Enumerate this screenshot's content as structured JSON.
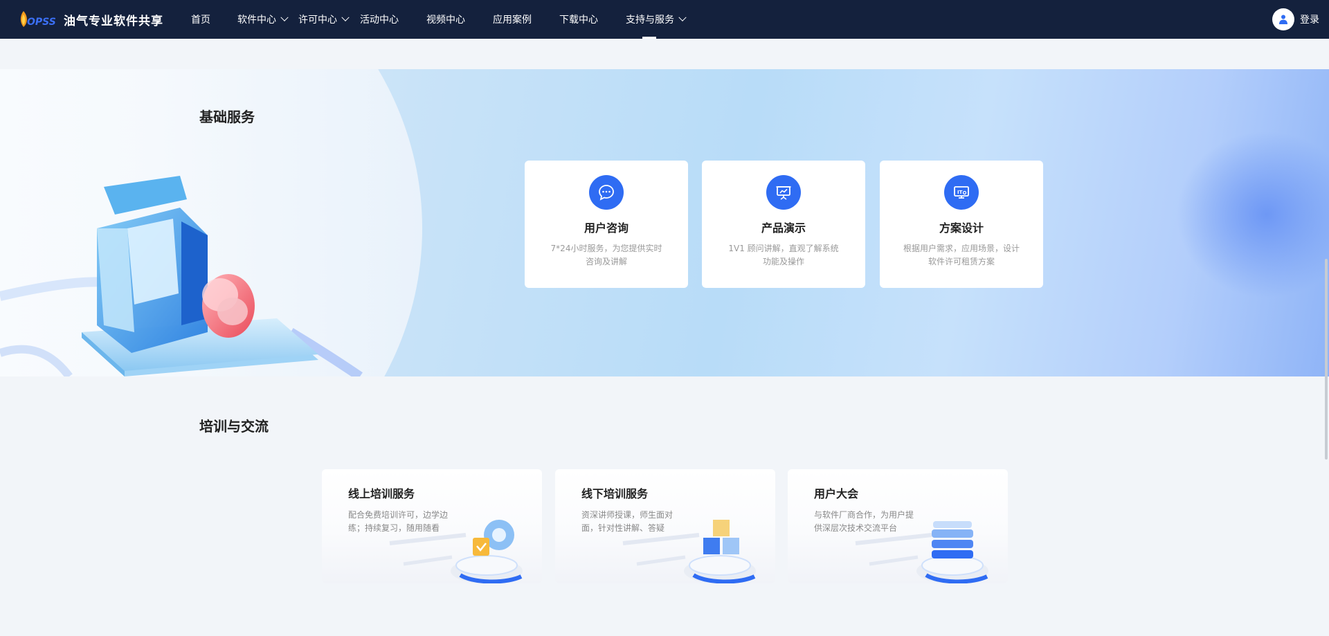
{
  "brand": {
    "logo_text": "OPSS",
    "name": "油气专业软件共享"
  },
  "nav": {
    "items": [
      {
        "label": "首页",
        "dropdown": false
      },
      {
        "label": "软件中心",
        "dropdown": true
      },
      {
        "label": "许可中心",
        "dropdown": true
      },
      {
        "label": "活动中心",
        "dropdown": false
      },
      {
        "label": "视频中心",
        "dropdown": false
      },
      {
        "label": "应用案例",
        "dropdown": false
      },
      {
        "label": "下载中心",
        "dropdown": false
      },
      {
        "label": "支持与服务",
        "dropdown": true,
        "active": true
      }
    ],
    "login_label": "登录"
  },
  "basic_services": {
    "title": "基础服务",
    "cards": [
      {
        "icon": "chat-bubble-icon",
        "title": "用户咨询",
        "desc": "7*24小时服务，为您提供实时咨询及讲解"
      },
      {
        "icon": "presentation-board-icon",
        "title": "产品演示",
        "desc": "1V1 顾问讲解，直观了解系统功能及操作"
      },
      {
        "icon": "it-monitor-icon",
        "title": "方案设计",
        "desc": "根据用户需求，应用场景，设计软件许可租赁方案"
      }
    ]
  },
  "training": {
    "title": "培训与交流",
    "cards": [
      {
        "icon": "gear-shield-icon",
        "title": "线上培训服务",
        "desc": "配合免费培训许可，边学边练；持续复习，随用随看"
      },
      {
        "icon": "cubes-icon",
        "title": "线下培训服务",
        "desc": "资深讲师授课，师生面对面，针对性讲解、答疑"
      },
      {
        "icon": "server-stack-icon",
        "title": "用户大会",
        "desc": "与软件厂商合作，为用户提供深层次技术交流平台"
      }
    ]
  },
  "colors": {
    "nav_bg": "#14213d",
    "accent": "#2f6cf3",
    "page_bg": "#f2f5f9"
  }
}
